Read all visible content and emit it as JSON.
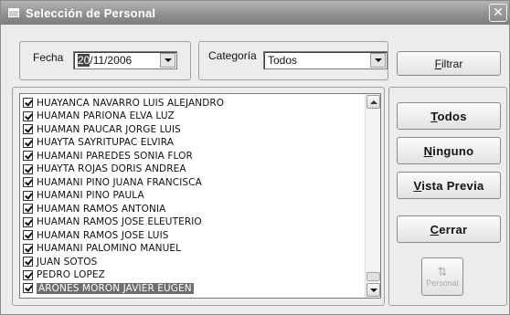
{
  "window": {
    "title": "Selección de Personal"
  },
  "filters": {
    "fecha_label": "Fecha",
    "fecha_value_selected": "20",
    "fecha_value_rest": "/11/2006",
    "categoria_label": "Categoría",
    "categoria_value": "Todos",
    "filtrar_label": "Filtrar"
  },
  "personal_list": [
    {
      "name": "HUAYANCA NAVARRO LUIS ALEJANDRO",
      "checked": true
    },
    {
      "name": "HUAMAN PARIONA ELVA LUZ",
      "checked": true
    },
    {
      "name": "HUAMAN PAUCAR JORGE LUIS",
      "checked": true
    },
    {
      "name": "HUAYTA SAYRITUPAC ELVIRA",
      "checked": true
    },
    {
      "name": "HUAMANI PAREDES SONIA FLOR",
      "checked": true
    },
    {
      "name": "HUAYTA ROJAS DORIS ANDREA",
      "checked": true
    },
    {
      "name": "HUAMANI PINO JUANA FRANCISCA",
      "checked": true
    },
    {
      "name": "HUAMANI PINO PAULA",
      "checked": true
    },
    {
      "name": "HUAMAN RAMOS ANTONIA",
      "checked": true
    },
    {
      "name": "HUAMAN RAMOS JOSE ELEUTERIO",
      "checked": true
    },
    {
      "name": "HUAMAN RAMOS JOSE LUIS",
      "checked": true
    },
    {
      "name": "HUAMANI PALOMINO MANUEL",
      "checked": true
    },
    {
      "name": "JUAN SOTOS",
      "checked": true
    },
    {
      "name": "PEDRO LOPEZ",
      "checked": true
    },
    {
      "name": "ARONES MORON JAVIER EUGEN",
      "checked": true,
      "selected": true
    }
  ],
  "actions": {
    "todos_label": "Todos",
    "ninguno_label": "Ninguno",
    "vista_previa_label": "Vista Previa",
    "cerrar_label": "Cerrar",
    "personal_sort_label": "Personal"
  },
  "icons": {
    "window_icon": "window-menu-icon",
    "close": "close-icon",
    "dropdown": "chevron-down-icon",
    "scroll_up": "scroll-up-icon",
    "scroll_down": "scroll-down-icon",
    "sort": "sort-az-icon"
  }
}
